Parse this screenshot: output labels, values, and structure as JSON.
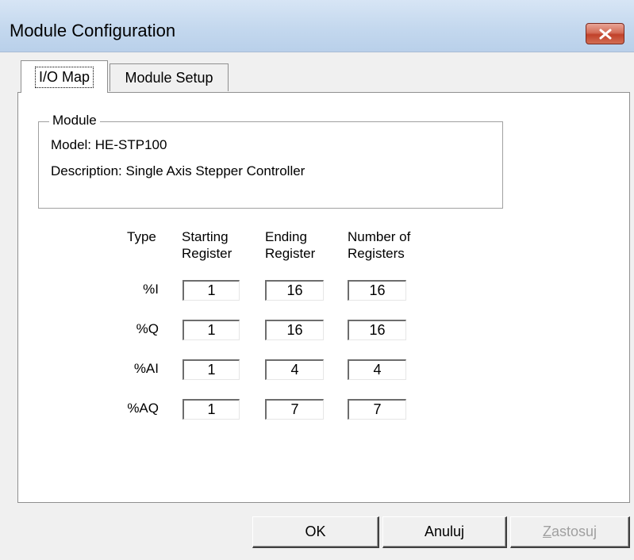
{
  "window": {
    "title": "Module Configuration",
    "close_icon": "close-icon"
  },
  "tabs": [
    {
      "label": "I/O Map",
      "active": true
    },
    {
      "label": "Module Setup",
      "active": false
    }
  ],
  "module": {
    "legend": "Module",
    "model_label": "Model:",
    "model_value": "HE-STP100",
    "description_label": "Description:",
    "description_value": "Single Axis Stepper Controller"
  },
  "table": {
    "headers": {
      "type": "Type",
      "starting_1": "Starting",
      "starting_2": "Register",
      "ending_1": "Ending",
      "ending_2": "Register",
      "number_1": "Number of",
      "number_2": "Registers"
    },
    "rows": [
      {
        "type": "%I",
        "start": "1",
        "end": "16",
        "count": "16"
      },
      {
        "type": "%Q",
        "start": "1",
        "end": "16",
        "count": "16"
      },
      {
        "type": "%AI",
        "start": "1",
        "end": "4",
        "count": "4"
      },
      {
        "type": "%AQ",
        "start": "1",
        "end": "7",
        "count": "7"
      }
    ]
  },
  "buttons": {
    "ok": "OK",
    "cancel": "Anuluj",
    "apply_accel": "Z",
    "apply_rest": "astosuj",
    "apply_disabled": true
  }
}
